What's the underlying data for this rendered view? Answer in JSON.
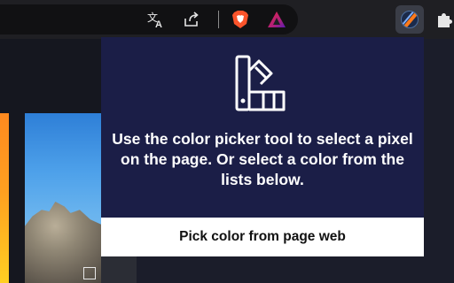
{
  "toolbar": {
    "icons": [
      "translate-icon",
      "share-icon",
      "brave-shields-icon",
      "brave-rewards-icon",
      "color-picker-extension-icon",
      "extensions-puzzle-icon"
    ]
  },
  "popup": {
    "message": "Use the color picker tool to select a pixel on the page. Or select a color from the lists below.",
    "pick_button_label": "Pick color from page web"
  },
  "colors": {
    "popup_background": "#1b1e47",
    "button_background": "#ffffff",
    "brave_orange": "#fb542b",
    "rewards_red": "#e5264a"
  }
}
